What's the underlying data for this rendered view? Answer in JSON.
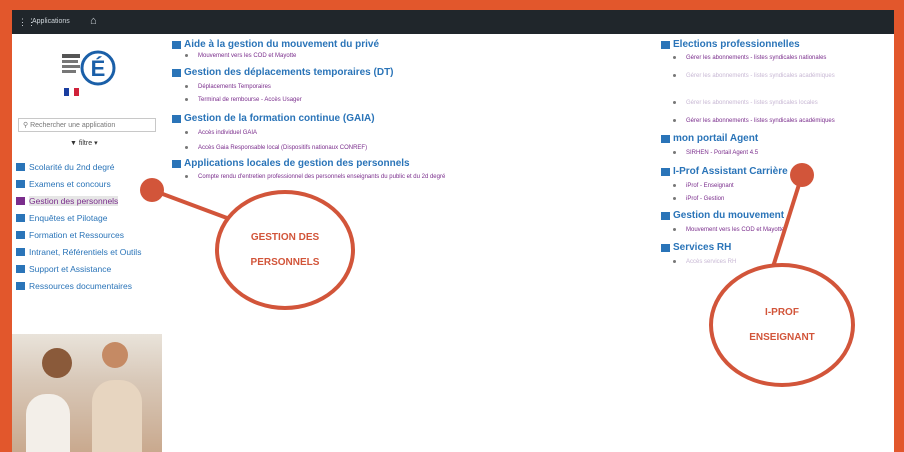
{
  "topbar": {
    "apps_label": "Applications",
    "grid_icon": "grid-icon",
    "home_icon": "home-icon"
  },
  "sidebar": {
    "search_placeholder": "Rechercher une application",
    "filter_label": "filtre",
    "items": [
      {
        "label": "Scolarité du 2nd degré"
      },
      {
        "label": "Examens et concours"
      },
      {
        "label": "Gestion des personnels"
      },
      {
        "label": "Enquêtes et Pilotage"
      },
      {
        "label": "Formation et Ressources"
      },
      {
        "label": "Intranet, Référentiels et Outils"
      },
      {
        "label": "Support et Assistance"
      },
      {
        "label": "Ressources documentaires"
      }
    ]
  },
  "sections_left": [
    {
      "title": "Aide à la gestion du mouvement du privé",
      "links": [
        "Mouvement vers les COD et Mayotte"
      ]
    },
    {
      "title": "Gestion des déplacements temporaires (DT)",
      "links": [
        "Déplacements Temporaires",
        "Terminal de rembourse - Accès Usager"
      ]
    },
    {
      "title": "Gestion de la formation continue (GAIA)",
      "links": [
        "Accès individuel GAIA",
        "Accès Gaia Responsable local (Dispositifs nationaux CONREF)"
      ]
    },
    {
      "title": "Applications locales de gestion des personnels",
      "links": [
        "Compte rendu d'entretien professionnel des personnels enseignants du public et du 2d degré"
      ]
    }
  ],
  "sections_right": [
    {
      "title": "Elections professionnelles",
      "links": [
        "Gérer les abonnements - listes syndicales nationales",
        "Gérer les abonnements - listes syndicales académiques",
        "Gérer les abonnements - listes syndicales locales",
        "Gérer les abonnements - listes syndicales académiques"
      ]
    },
    {
      "title": "mon portail Agent",
      "links": [
        "SIRHEN - Portail Agent 4.5"
      ]
    },
    {
      "title": "I-Prof Assistant Carrière",
      "links": [
        "iProf - Enseignant",
        "iProf - Gestion"
      ]
    },
    {
      "title": "Gestion du mouvement",
      "links": [
        "Mouvement vers les COD et Mayotte"
      ]
    },
    {
      "title": "Services RH",
      "links": [
        "Accès services RH"
      ]
    }
  ],
  "callouts": {
    "left_line1": "GESTION DES",
    "left_line2": "PERSONNELS",
    "right_line1": "I-PROF",
    "right_line2": "ENSEIGNANT"
  },
  "colors": {
    "border": "#e2572c",
    "accent": "#d2553a",
    "link_blue": "#2a74b8",
    "link_purple": "#7a2d8c"
  }
}
